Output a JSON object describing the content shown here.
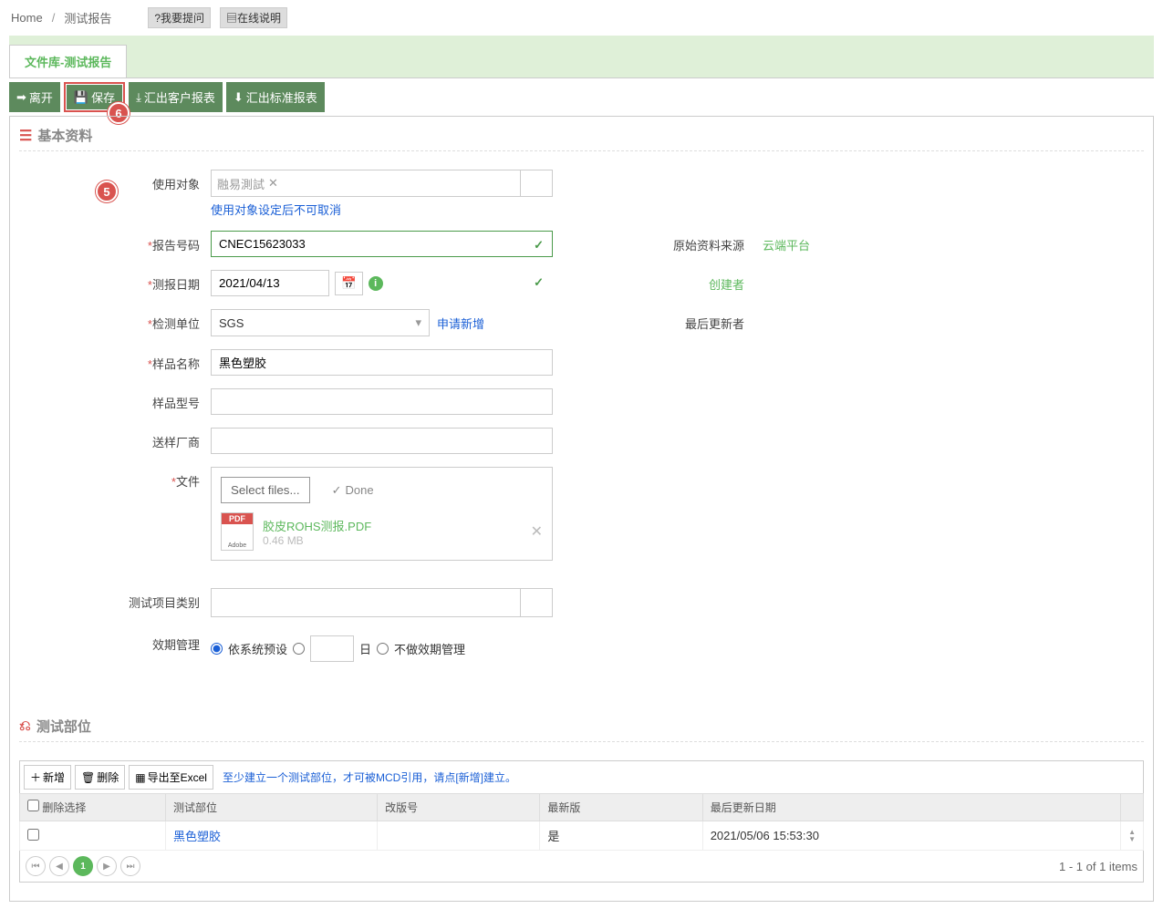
{
  "breadcrumb": {
    "home": "Home",
    "page": "测试报告"
  },
  "help": {
    "ask": "?我要提问",
    "manual": "在线说明"
  },
  "tab": {
    "label": "文件库-测试报告"
  },
  "toolbar": {
    "leave": "离开",
    "save": "保存",
    "exportCustomer": "汇出客户报表",
    "exportStandard": "汇出标准报表"
  },
  "callouts": {
    "five": "5",
    "six": "6"
  },
  "section1": {
    "title": "基本资料"
  },
  "form": {
    "useTarget": {
      "label": "使用对象",
      "tag": "融易測試",
      "hint": "使用对象设定后不可取消"
    },
    "reportNo": {
      "label": "报告号码",
      "value": "CNEC15623033"
    },
    "reportDate": {
      "label": "测报日期",
      "value": "2021/04/13"
    },
    "testOrg": {
      "label": "检测单位",
      "value": "SGS",
      "addLink": "申请新增"
    },
    "sampleName": {
      "label": "样品名称",
      "value": "黑色塑胶"
    },
    "sampleModel": {
      "label": "样品型号",
      "value": ""
    },
    "supplier": {
      "label": "送样厂商",
      "value": ""
    },
    "file": {
      "label": "文件",
      "selectBtn": "Select files...",
      "done": "Done",
      "uploaded": {
        "name": "胶皮ROHS测报.PDF",
        "size": "0.46 MB"
      }
    },
    "testCategory": {
      "label": "测试项目类别",
      "value": ""
    },
    "expiry": {
      "label": "效期管理",
      "opt1": "依系统预设",
      "daysSuffix": "日",
      "opt3": "不做效期管理"
    }
  },
  "side": {
    "source": {
      "label": "原始资料来源",
      "value": "云端平台"
    },
    "creator": {
      "label": "创建者",
      "value": ""
    },
    "updater": {
      "label": "最后更新者",
      "value": ""
    }
  },
  "section2": {
    "title": "测试部位"
  },
  "gridToolbar": {
    "add": "新增",
    "delete": "删除",
    "exportExcel": "导出至Excel",
    "hint": "至少建立一个测试部位，才可被MCD引用，请点[新增]建立。"
  },
  "grid": {
    "headers": {
      "deleteSel": "删除选择",
      "part": "测试部位",
      "version": "改版号",
      "latest": "最新版",
      "updated": "最后更新日期"
    },
    "rows": [
      {
        "part": "黑色塑胶",
        "version": "",
        "latest": "是",
        "updated": "2021/05/06 15:53:30"
      }
    ]
  },
  "pager": {
    "current": "1",
    "info": "1 - 1 of 1 items"
  }
}
